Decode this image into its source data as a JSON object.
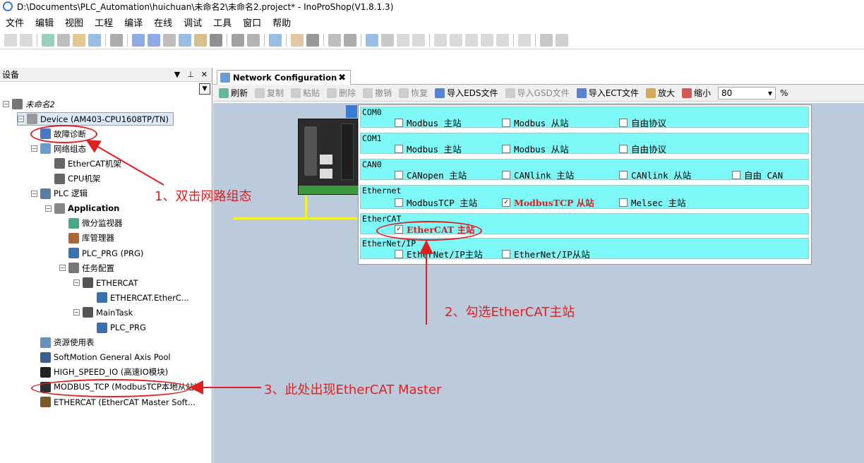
{
  "window": {
    "title": "D:\\Documents\\PLC_Automation\\huichuan\\未命名2\\未命名2.project* - InoProShop(V1.8.1.3)"
  },
  "menu": [
    "文件",
    "编辑",
    "视图",
    "工程",
    "编译",
    "在线",
    "调试",
    "工具",
    "窗口",
    "帮助"
  ],
  "devices_panel": {
    "title": "设备",
    "tree": [
      {
        "label": "未命名2",
        "indent": 0,
        "expander": "−",
        "icon": "project-icon",
        "italic": true
      },
      {
        "label": "Device (AM403-CPU1608TP/TN)",
        "indent": 1,
        "expander": "−",
        "icon": "device-icon",
        "selected": true
      },
      {
        "label": "故障诊断",
        "indent": 2,
        "expander": "",
        "icon": "diagnosis-icon"
      },
      {
        "label": "网络组态",
        "indent": 2,
        "expander": "−",
        "icon": "network-config-icon"
      },
      {
        "label": "EtherCAT机架",
        "indent": 3,
        "expander": "",
        "icon": "rack-icon"
      },
      {
        "label": "CPU机架",
        "indent": 3,
        "expander": "",
        "icon": "rack-icon"
      },
      {
        "label": "PLC 逻辑",
        "indent": 2,
        "expander": "−",
        "icon": "plc-logic-icon"
      },
      {
        "label": "Application",
        "indent": 3,
        "expander": "−",
        "icon": "gear-icon",
        "bold": true
      },
      {
        "label": "微分监视器",
        "indent": 4,
        "expander": "",
        "icon": "watch-icon"
      },
      {
        "label": "库管理器",
        "indent": 4,
        "expander": "",
        "icon": "library-icon"
      },
      {
        "label": "PLC_PRG (PRG)",
        "indent": 4,
        "expander": "",
        "icon": "program-icon"
      },
      {
        "label": "任务配置",
        "indent": 4,
        "expander": "−",
        "icon": "task-config-icon"
      },
      {
        "label": "ETHERCAT",
        "indent": 5,
        "expander": "−",
        "icon": "task-icon"
      },
      {
        "label": "ETHERCAT.EtherC...",
        "indent": 6,
        "expander": "",
        "icon": "program-icon"
      },
      {
        "label": "MainTask",
        "indent": 5,
        "expander": "−",
        "icon": "task-icon"
      },
      {
        "label": "PLC_PRG",
        "indent": 6,
        "expander": "",
        "icon": "program-icon"
      },
      {
        "label": "资源使用表",
        "indent": 2,
        "expander": "",
        "icon": "table-icon"
      },
      {
        "label": "SoftMotion General Axis Pool",
        "indent": 2,
        "expander": "",
        "icon": "axis-pool-icon"
      },
      {
        "label": "HIGH_SPEED_IO (高速IO模块)",
        "indent": 2,
        "expander": "",
        "icon": "io-module-icon"
      },
      {
        "label": "MODBUS_TCP (ModbusTCP本地从站)",
        "indent": 2,
        "expander": "",
        "icon": "modbus-icon"
      },
      {
        "label": "ETHERCAT (EtherCAT Master Soft...",
        "indent": 2,
        "expander": "",
        "icon": "ethercat-master-icon"
      }
    ]
  },
  "editor": {
    "tab_label": "Network Configuration",
    "toolbar": [
      {
        "label": "刷新",
        "disabled": false
      },
      {
        "label": "复制",
        "disabled": true
      },
      {
        "label": "粘贴",
        "disabled": true
      },
      {
        "label": "删除",
        "disabled": true
      },
      {
        "label": "撤销",
        "disabled": true
      },
      {
        "label": "恢复",
        "disabled": true
      },
      {
        "label": "导入EDS文件",
        "disabled": false
      },
      {
        "label": "导入GSD文件",
        "disabled": true
      },
      {
        "label": "导入ECT文件",
        "disabled": false
      },
      {
        "label": "放大",
        "disabled": false
      },
      {
        "label": "缩小",
        "disabled": false
      }
    ],
    "zoom_value": "80",
    "zoom_unit": "%",
    "config_rows": [
      {
        "name": "COM0",
        "options": [
          {
            "label": "Modbus 主站",
            "checked": false
          },
          {
            "label": "Modbus 从站",
            "checked": false
          },
          {
            "label": "自由协议",
            "checked": false
          }
        ]
      },
      {
        "name": "COM1",
        "options": [
          {
            "label": "Modbus 主站",
            "checked": false
          },
          {
            "label": "Modbus 从站",
            "checked": false
          },
          {
            "label": "自由协议",
            "checked": false
          }
        ]
      },
      {
        "name": "CAN0",
        "options": [
          {
            "label": "CANopen 主站",
            "checked": false
          },
          {
            "label": "CANlink 主站",
            "checked": false
          },
          {
            "label": "CANlink 从站",
            "checked": false
          },
          {
            "label": "自由 CAN",
            "checked": false
          }
        ]
      },
      {
        "name": "Ethernet",
        "options": [
          {
            "label": "ModbusTCP 主站",
            "checked": false
          },
          {
            "label": "ModbusTCP 从站",
            "checked": true
          },
          {
            "label": "Melsec 主站",
            "checked": false
          }
        ]
      },
      {
        "name": "EtherCAT",
        "options": [
          {
            "label": "EtherCAT 主站",
            "checked": true
          }
        ]
      },
      {
        "name": "EtherNet/IP",
        "options": [
          {
            "label": "EtherNet/IP主站",
            "checked": false
          },
          {
            "label": "EtherNet/IP从站",
            "checked": false
          }
        ]
      }
    ]
  },
  "annotations": {
    "step1": "1、双击网路组态",
    "step2": "2、勾选EtherCAT主站",
    "step3": "3、此处出现EtherCAT Master"
  },
  "colors": {
    "accent_red": "#e02020",
    "row_bg": "#7ff8f8",
    "canvas_bg": "#bccbdc",
    "bus_yellow": "#f2f229"
  }
}
